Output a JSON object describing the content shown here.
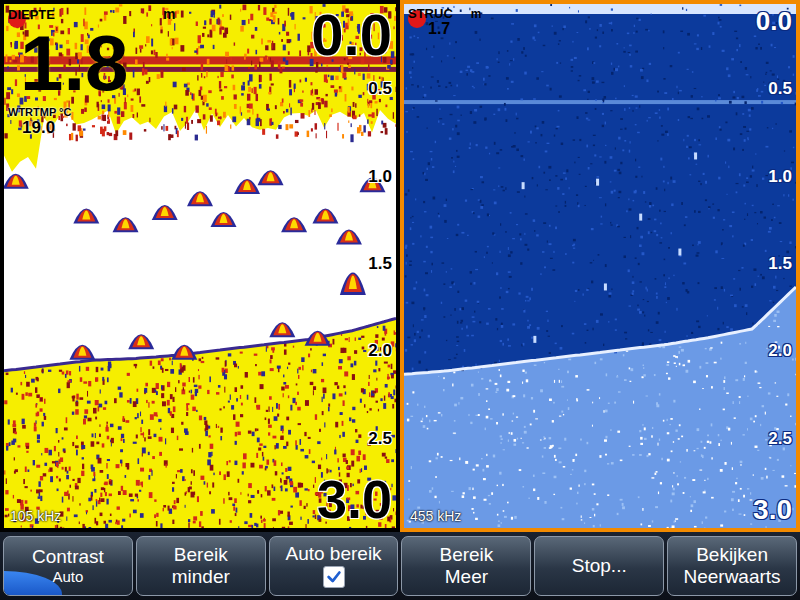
{
  "panels": [
    {
      "kind": "sonar",
      "title": "DIEPTE",
      "unit": "m",
      "depth": "1.8",
      "range_top": "0.0",
      "range_bottom": "3.0",
      "ticks": [
        "0.5",
        "1.0",
        "1.5",
        "2.0",
        "2.5"
      ],
      "water_temp_label": "WTRTMP °C",
      "water_temp": "19.0",
      "frequency": "105 kHz",
      "selected": false,
      "bottom_profile": [
        2.1,
        2.07,
        2.04,
        2.03,
        2.01,
        1.98,
        1.95,
        1.92,
        1.87,
        1.8
      ],
      "fish": [
        {
          "at": 0.03,
          "depth": 1.0
        },
        {
          "at": 0.21,
          "depth": 1.2
        },
        {
          "at": 0.31,
          "depth": 1.25
        },
        {
          "at": 0.41,
          "depth": 1.18
        },
        {
          "at": 0.5,
          "depth": 1.1
        },
        {
          "at": 0.56,
          "depth": 1.22
        },
        {
          "at": 0.62,
          "depth": 1.03
        },
        {
          "at": 0.68,
          "depth": 0.98
        },
        {
          "at": 0.74,
          "depth": 1.25
        },
        {
          "at": 0.82,
          "depth": 1.2
        },
        {
          "at": 0.88,
          "depth": 1.32
        },
        {
          "at": 0.94,
          "depth": 1.02
        },
        {
          "at": 0.2,
          "depth": 1.98
        },
        {
          "at": 0.35,
          "depth": 1.92
        },
        {
          "at": 0.46,
          "depth": 1.98
        },
        {
          "at": 0.71,
          "depth": 1.85
        },
        {
          "at": 0.8,
          "depth": 1.9
        },
        {
          "at": 0.89,
          "depth": 1.58
        }
      ]
    },
    {
      "kind": "structure",
      "title": "STRUC",
      "unit": "m",
      "depth": "1.7",
      "range_top": "0.0",
      "range_bottom": "3.0",
      "ticks": [
        "0.5",
        "1.0",
        "1.5",
        "2.0",
        "2.5"
      ],
      "frequency": "455 kHz",
      "selected": true,
      "bottom_profile": [
        2.12,
        2.1,
        2.07,
        2.04,
        2.01,
        1.98,
        1.95,
        1.91,
        1.86,
        1.62
      ],
      "echoes": [
        {
          "at": 0.3,
          "depth": 1.02
        },
        {
          "at": 0.49,
          "depth": 1.0
        },
        {
          "at": 0.51,
          "depth": 1.6
        },
        {
          "at": 0.6,
          "depth": 1.2
        },
        {
          "at": 0.7,
          "depth": 1.4
        },
        {
          "at": 0.33,
          "depth": 1.9
        },
        {
          "at": 0.74,
          "depth": 0.85
        }
      ]
    }
  ],
  "buttons": [
    {
      "kind": "level",
      "label": "Contrast",
      "sub": "Auto",
      "level": 0.45
    },
    {
      "kind": "text",
      "label": "Bereik",
      "sub": "minder"
    },
    {
      "kind": "checkbox",
      "label": "Auto bereik",
      "checked": true
    },
    {
      "kind": "text",
      "label": "Bereik",
      "sub": "Meer"
    },
    {
      "kind": "single",
      "label": "Stop..."
    },
    {
      "kind": "text",
      "label": "Bekijken",
      "sub": "Neerwaarts"
    }
  ]
}
